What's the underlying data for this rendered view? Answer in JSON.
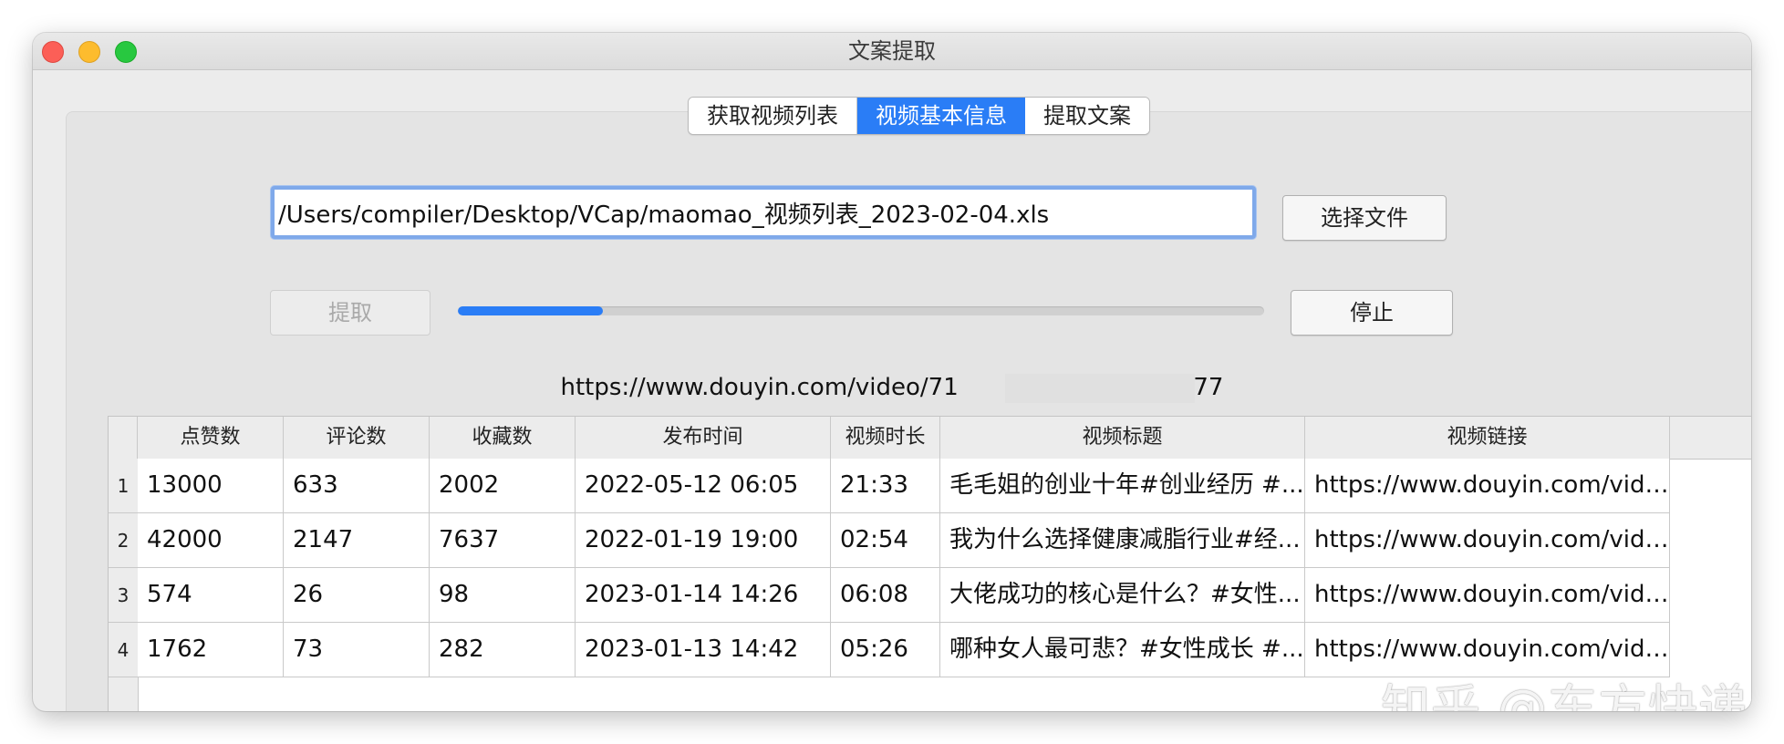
{
  "window": {
    "title": "文案提取"
  },
  "tabs": [
    {
      "label": "获取视频列表",
      "active": false
    },
    {
      "label": "视频基本信息",
      "active": true
    },
    {
      "label": "提取文案",
      "active": false
    }
  ],
  "file": {
    "path": "/Users/compiler/Desktop/VCap/maomao_视频列表_2023-02-04.xls",
    "choose_label": "选择文件"
  },
  "actions": {
    "extract_label": "提取",
    "stop_label": "停止",
    "progress": 0.18
  },
  "status": {
    "url": "https://www.douyin.com/video/71        37577"
  },
  "table": {
    "columns": [
      "点赞数",
      "评论数",
      "收藏数",
      "发布时间",
      "视频时长",
      "视频标题",
      "视频链接"
    ],
    "rows": [
      {
        "num": "1",
        "cells": [
          "13000",
          "633",
          "2002",
          "2022-05-12 06:05",
          "21:33",
          "毛毛姐的创业十年#创业经历 #...",
          "https://www.douyin.com/vide..."
        ]
      },
      {
        "num": "2",
        "cells": [
          "42000",
          "2147",
          "7637",
          "2022-01-19 19:00",
          "02:54",
          "我为什么选择健康减脂行业#经...",
          "https://www.douyin.com/vide..."
        ]
      },
      {
        "num": "3",
        "cells": [
          "574",
          "26",
          "98",
          "2023-01-14 14:26",
          "06:08",
          "大佬成功的核心是什么？#女性...",
          "https://www.douyin.com/vide..."
        ]
      },
      {
        "num": "4",
        "cells": [
          "1762",
          "73",
          "282",
          "2023-01-13 14:42",
          "05:26",
          "哪种女人最可悲？#女性成长 #...",
          "https://www.douyin.com/vide..."
        ]
      }
    ]
  },
  "watermark": {
    "text": "知乎 @东方快递"
  },
  "colors": {
    "accent": "#2a7df6",
    "close": "#fc5f57",
    "minimize": "#fdbc2e",
    "maximize": "#28c840"
  }
}
